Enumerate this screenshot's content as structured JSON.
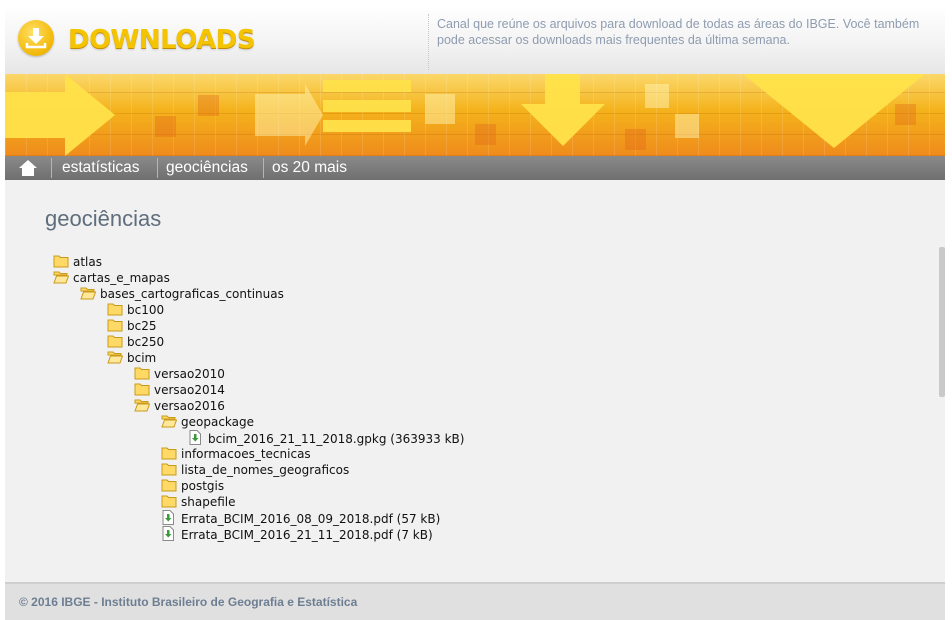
{
  "header": {
    "logo_text": "DOWNLOADS",
    "description": "Canal que reúne os arquivos para download de todas as áreas do IBGE. Você também pode acessar os downloads mais frequentes da última semana.",
    "brand_color": "#f5c400"
  },
  "nav": {
    "home_icon": "home-icon",
    "items": [
      {
        "label": "estatísticas"
      },
      {
        "label": "geociências"
      },
      {
        "label": "os 20 mais"
      }
    ]
  },
  "content": {
    "title": "geociências"
  },
  "tree": [
    {
      "type": "folder",
      "open": false,
      "label": "atlas",
      "depth": 0
    },
    {
      "type": "folder",
      "open": true,
      "label": "cartas_e_mapas",
      "depth": 0
    },
    {
      "type": "folder",
      "open": true,
      "label": "bases_cartograficas_continuas",
      "depth": 1
    },
    {
      "type": "folder",
      "open": false,
      "label": "bc100",
      "depth": 2
    },
    {
      "type": "folder",
      "open": false,
      "label": "bc25",
      "depth": 2
    },
    {
      "type": "folder",
      "open": false,
      "label": "bc250",
      "depth": 2
    },
    {
      "type": "folder",
      "open": true,
      "label": "bcim",
      "depth": 2
    },
    {
      "type": "folder",
      "open": false,
      "label": "versao2010",
      "depth": 3
    },
    {
      "type": "folder",
      "open": false,
      "label": "versao2014",
      "depth": 3
    },
    {
      "type": "folder",
      "open": true,
      "label": "versao2016",
      "depth": 3
    },
    {
      "type": "folder",
      "open": true,
      "label": "geopackage",
      "depth": 4
    },
    {
      "type": "file",
      "label": "bcim_2016_21_11_2018.gpkg (363933 kB)",
      "depth": 5
    },
    {
      "type": "folder",
      "open": false,
      "label": "informacoes_tecnicas",
      "depth": 4
    },
    {
      "type": "folder",
      "open": false,
      "label": "lista_de_nomes_geograficos",
      "depth": 4
    },
    {
      "type": "folder",
      "open": false,
      "label": "postgis",
      "depth": 4
    },
    {
      "type": "folder",
      "open": false,
      "label": "shapefile",
      "depth": 4
    },
    {
      "type": "file",
      "label": "Errata_BCIM_2016_08_09_2018.pdf (57 kB)",
      "depth": 4
    },
    {
      "type": "file",
      "label": "Errata_BCIM_2016_21_11_2018.pdf (7 kB)",
      "depth": 4
    }
  ],
  "icons": {
    "folder_closed": "folder-icon",
    "folder_open": "folder-open-icon",
    "file": "download-file-icon"
  },
  "footer": {
    "text": "© 2016 IBGE - Instituto Brasileiro de Geografia e Estatística"
  }
}
